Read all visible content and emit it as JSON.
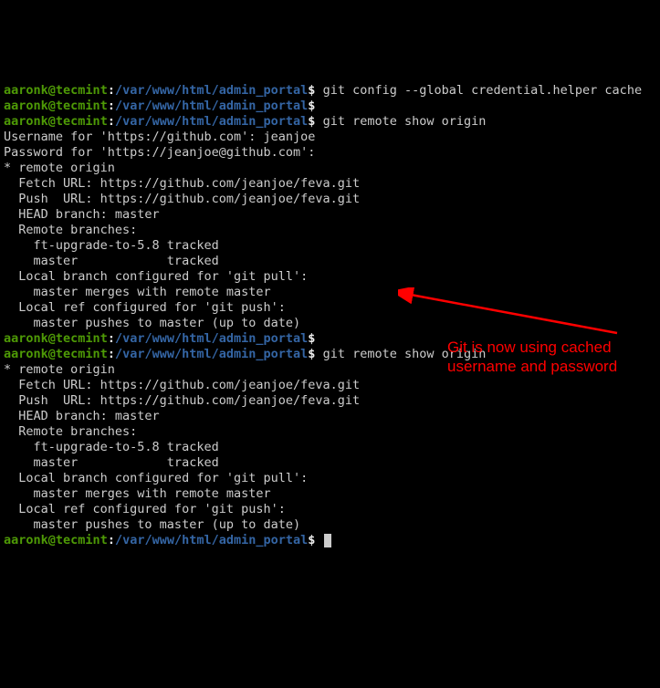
{
  "p": {
    "user": "aaronk",
    "host": "tecmint",
    "path": "/var/www/html/admin_portal",
    "sym": "$"
  },
  "cmd": {
    "cfg": "git config --global credential.helper cache",
    "show": "git remote show origin"
  },
  "auth": {
    "user_prompt": "Username for 'https://github.com': ",
    "user_val": "jeanjoe",
    "pass_prompt": "Password for 'https://jeanjoe@github.com': "
  },
  "remote": {
    "hdr": "* remote origin",
    "fetch": "  Fetch URL: https://github.com/jeanjoe/feva.git",
    "push": "  Push  URL: https://github.com/jeanjoe/feva.git",
    "head": "  HEAD branch: master",
    "rb_hdr": "  Remote branches:",
    "rb1": "    ft-upgrade-to-5.8 tracked",
    "rb2": "    master            tracked",
    "pull_hdr": "  Local branch configured for 'git pull':",
    "pull": "    master merges with remote master",
    "push_hdr": "  Local ref configured for 'git push':",
    "pushl": "    master pushes to master (up to date)"
  },
  "ann": {
    "l1": "Git is now using cached",
    "l2": "username and password"
  }
}
